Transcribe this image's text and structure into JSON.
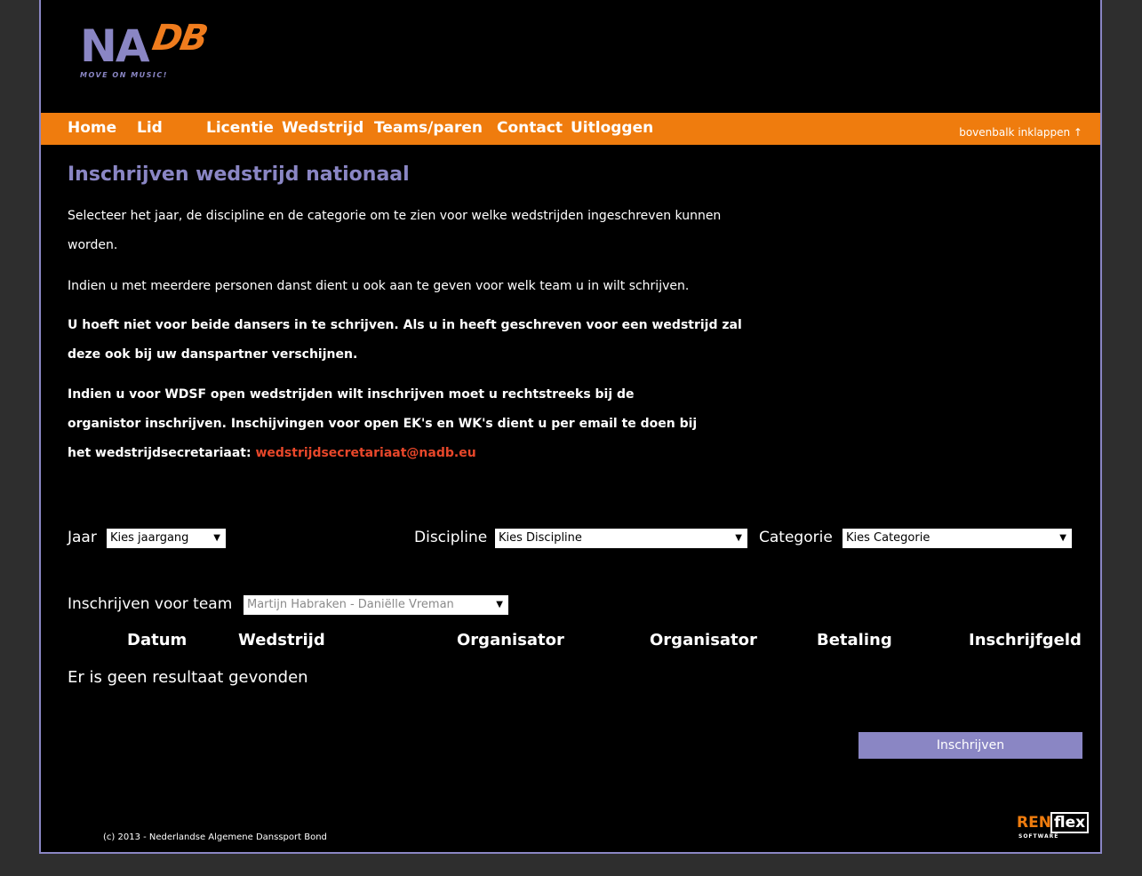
{
  "logo": {
    "main": "NA",
    "accent": "DB",
    "tagline": "MOVE ON MUSIC!"
  },
  "nav": {
    "items": [
      "Home",
      "Lid",
      "Licentie",
      "Wedstrijd",
      "Teams/paren",
      "Contact",
      "Uitloggen"
    ],
    "collapse": "bovenbalk inklappen ↑"
  },
  "content": {
    "title": "Inschrijven wedstrijd nationaal",
    "p1": "Selecteer het jaar, de discipline en de categorie om te zien voor welke wedstrijden ingeschreven kunnen worden.",
    "p2": "Indien u met meerdere personen danst dient u ook aan te geven voor welk team u in wilt schrijven.",
    "p3": "U hoeft niet voor beide dansers in te schrijven. Als u in heeft geschreven voor een wedstrijd zal deze ook bij uw danspartner verschijnen.",
    "p4": "Indien u voor WDSF open wedstrijden wilt inschrijven moet u rechtstreeks bij de organistor inschrijven. Inschijvingen voor open EK's en WK's dient u per email te doen bij het wedstrijdsecretariaat:",
    "email": "wedstrijdsecretariaat@nadb.eu"
  },
  "filters": {
    "jaar_label": "Jaar",
    "jaar_value": "Kies jaargang",
    "discipline_label": "Discipline",
    "discipline_value": "Kies Discipline",
    "categorie_label": "Categorie",
    "categorie_value": "Kies Categorie",
    "team_label": "Inschrijven voor team",
    "team_value": "Martijn Habraken - Daniëlle Vreman"
  },
  "table": {
    "headers": [
      "Datum",
      "Wedstrijd",
      "Organisator",
      "Organisator",
      "Betaling",
      "Inschrijfgeld"
    ],
    "empty": "Er is geen resultaat gevonden"
  },
  "submit_label": "Inschrijven",
  "footer": "(c) 2013 - Nederlandse Algemene Danssport Bond",
  "brand": {
    "ren": "REN",
    "flex": "flex",
    "software": "SOFTWARE"
  },
  "colors": {
    "nav": "#ef7c0e",
    "accent": "#8a86c4",
    "link": "#e8472a"
  }
}
